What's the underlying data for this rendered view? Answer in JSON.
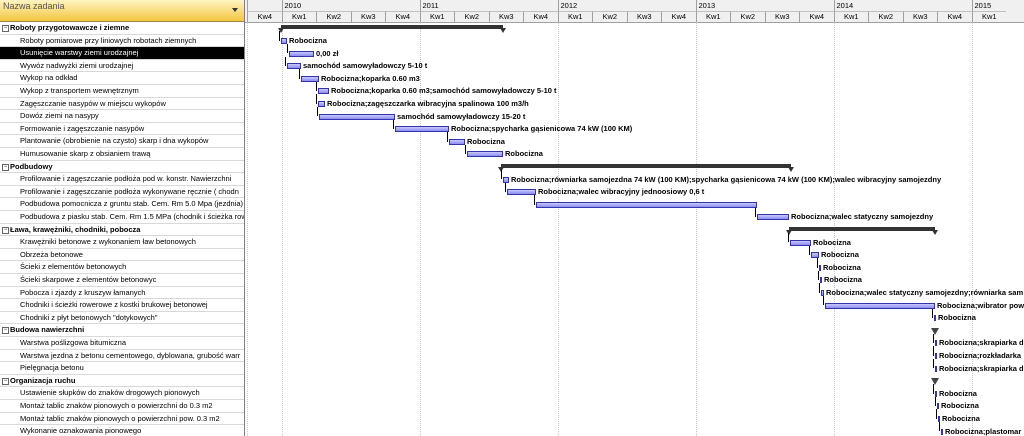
{
  "header": {
    "column_title": "Nazwa zadania"
  },
  "timescale": {
    "years": [
      "",
      "2010",
      "2011",
      "2012",
      "2013",
      "2014",
      "2015"
    ],
    "quarters": [
      "Kw4",
      "Kw1",
      "Kw2",
      "Kw3",
      "Kw4",
      "Kw1",
      "Kw2",
      "Kw3",
      "Kw4",
      "Kw1",
      "Kw2",
      "Kw3",
      "Kw4",
      "Kw1",
      "Kw2",
      "Kw3",
      "Kw4",
      "Kw1",
      "Kw2",
      "Kw3",
      "Kw4",
      "Kw1"
    ]
  },
  "tasks": [
    {
      "name": "Roboty przygotowawcze i ziemne",
      "summary": true
    },
    {
      "name": "Roboty pomiarowe przy liniowych robotach ziemnych",
      "label": "Robocizna"
    },
    {
      "name": "Usunięcie warstwy ziemi urodzajnej",
      "label": "0,00 zł",
      "selected": true
    },
    {
      "name": "Wywóz nadwyżki ziemi urodzajnej",
      "label": "samochód samowyładowczy 5-10 t"
    },
    {
      "name": "Wykop na odkład",
      "label": "Robocizna;koparka 0.60 m3"
    },
    {
      "name": "Wykop z transportem wewnętrznym",
      "label": "Robocizna;koparka 0.60 m3;samochód samowyładowczy 5-10 t"
    },
    {
      "name": "Zagęszczanie nasypów w miejscu wykopów",
      "label": "Robocizna;zagęszczarka wibracyjna spalinowa 100 m3/h"
    },
    {
      "name": "Dowóz ziemi na nasypy",
      "label": "samochód samowyładowczy 15-20 t"
    },
    {
      "name": "Formowanie i zagęszczanie nasypów",
      "label": "Robocizna;spycharka gąsienicowa 74 kW (100 KM)"
    },
    {
      "name": "Plantowanie (obrobienie na czysto) skarp i dna wykopów",
      "label": "Robocizna"
    },
    {
      "name": "Humusowanie skarp z obsianiem trawą",
      "label": "Robocizna"
    },
    {
      "name": "Podbudowy",
      "summary": true
    },
    {
      "name": "Profilowanie i zagęszczanie podłoża pod w. konstr. Nawierzchni",
      "label": "Robocizna;równiarka samojezdna 74 kW (100 KM);spycharka gąsienicowa 74 kW (100 KM);walec wibracyjny samojezdny"
    },
    {
      "name": "Profilowanie i zagęszczanie podłoża wykonywane ręcznie  ( chodn",
      "label": "Robocizna;walec wibracyjny jednoosiowy 0,6 t"
    },
    {
      "name": "Podbudowa pomocnicza z gruntu stab. Cem. Rm 5.0 Mpa (jezdnia)",
      "label": ""
    },
    {
      "name": "Podbudowa z piasku stab. Cem. Rm 1.5 MPa  (chodnik i ścieżka row",
      "label": "Robocizna;walec statyczny samojezdny"
    },
    {
      "name": "Ława, krawężniki, chodniki, pobocza",
      "summary": true
    },
    {
      "name": "Krawężniki betonowe z wykonaniem ław betonowych",
      "label": "Robocizna"
    },
    {
      "name": "Obrzeża betonowe",
      "label": "Robocizna"
    },
    {
      "name": "Ścieki z elementów betonowych",
      "label": "Robocizna"
    },
    {
      "name": "Ścieki skarpowe z elementów betonowyc",
      "label": "Robocizna"
    },
    {
      "name": "Pobocza i zjazdy z kruszyw łamanych",
      "label": "Robocizna;walec statyczny samojezdny;równiarka sam"
    },
    {
      "name": "Chodniki i ścieżki rowerowe z kostki brukowej betonowej",
      "label": "Robocizna;wibrator pow"
    },
    {
      "name": "Chodniki z płyt betonowych \"dotykowych\"",
      "label": "Robocizna"
    },
    {
      "name": "Budowa nawierzchni",
      "summary": true
    },
    {
      "name": "Warstwa poślizgowa bitumiczna",
      "label": "Robocizna;skrapiarka d"
    },
    {
      "name": "Warstwa jezdna z betonu cementowego, dyblowana, grubość warr",
      "label": "Robocizna;rozkładarka"
    },
    {
      "name": "Pielęgnacja betonu",
      "label": "Robocizna;skrapiarka d"
    },
    {
      "name": "Organizacja ruchu",
      "summary": true
    },
    {
      "name": "Ustawienie słupków do znaków drogowych pionowych",
      "label": "Robocizna"
    },
    {
      "name": "Montaż tablic znaków pionowych o powierzchni do 0.3 m2",
      "label": "Robocizna"
    },
    {
      "name": "Montaż tablic znaków pionowych o powierzchni pow. 0.3 m2",
      "label": "Robocizna"
    },
    {
      "name": "Wykonanie oznakowania pionowego",
      "label": "Robocizna;plastomar"
    }
  ]
}
